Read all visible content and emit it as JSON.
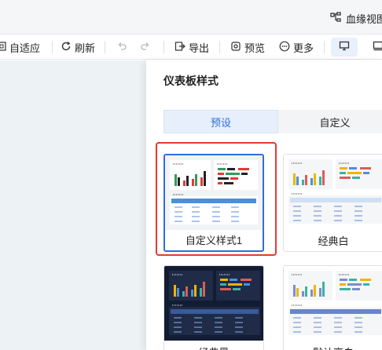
{
  "header": {
    "lineage_label": "血缘视图"
  },
  "toolbar": {
    "fit_label": "自适应",
    "refresh_label": "刷新",
    "export_label": "导出",
    "preview_label": "预览",
    "more_label": "更多"
  },
  "panel": {
    "title": "仪表板样式",
    "tabs": [
      {
        "label": "预设",
        "active": true
      },
      {
        "label": "自定义",
        "active": false
      }
    ],
    "styles": [
      {
        "label": "自定义样式1",
        "selected": true,
        "theme": "light-grey"
      },
      {
        "label": "经典白",
        "selected": false,
        "theme": "white"
      },
      {
        "label": "经典黑",
        "selected": false,
        "theme": "dark"
      },
      {
        "label": "默认亮白",
        "selected": false,
        "theme": "white-blue"
      }
    ]
  },
  "colors": {
    "accent": "#2f6fd6",
    "highlight": "#e53935",
    "canvas": "#edf2f5"
  }
}
